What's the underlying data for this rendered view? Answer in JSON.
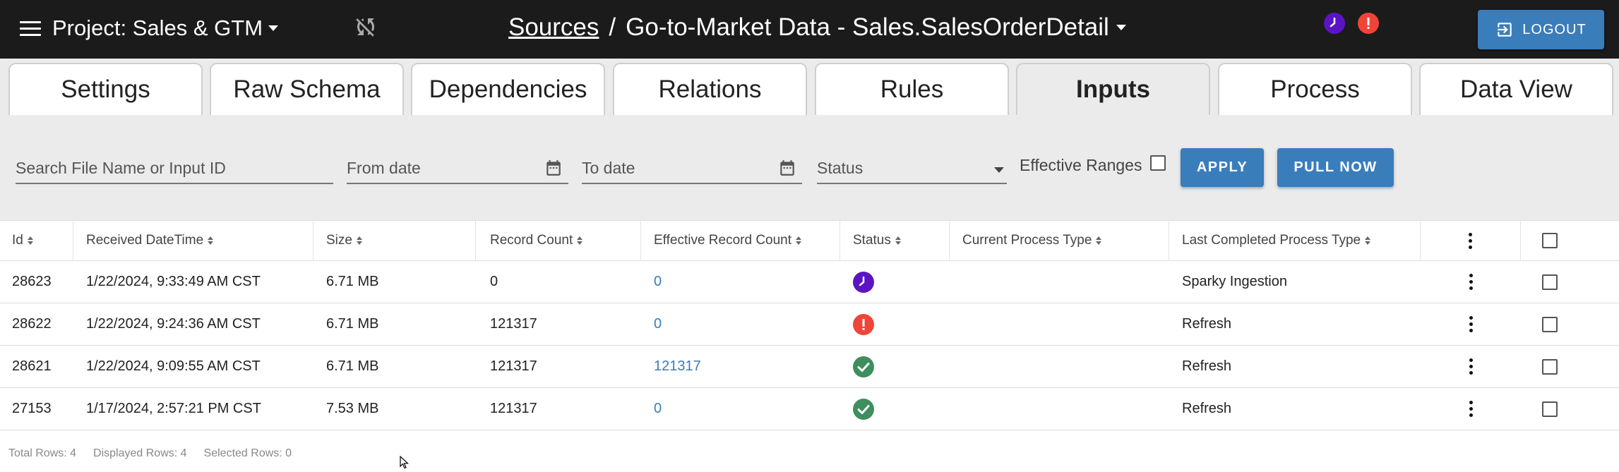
{
  "header": {
    "project_label": "Project:",
    "project_name": "Sales & GTM",
    "breadcrumb_link": "Sources",
    "breadcrumb_sep": "/",
    "page_title": "Go-to-Market Data - Sales.SalesOrderDetail",
    "logout_label": "LOGOUT",
    "status_colors": {
      "clock": "#5b14c4",
      "error": "#f04438"
    }
  },
  "tabs": [
    {
      "label": "Settings",
      "active": false
    },
    {
      "label": "Raw Schema",
      "active": false
    },
    {
      "label": "Dependencies",
      "active": false
    },
    {
      "label": "Relations",
      "active": false
    },
    {
      "label": "Rules",
      "active": false
    },
    {
      "label": "Inputs",
      "active": true
    },
    {
      "label": "Process",
      "active": false
    },
    {
      "label": "Data View",
      "active": false
    }
  ],
  "filters": {
    "search_placeholder": "Search File Name or Input ID",
    "from_placeholder": "From date",
    "to_placeholder": "To date",
    "status_placeholder": "Status",
    "effective_ranges_label": "Effective Ranges",
    "apply_label": "APPLY",
    "pull_now_label": "PULL NOW"
  },
  "table": {
    "columns": [
      "Id",
      "Received DateTime",
      "Size",
      "Record Count",
      "Effective Record Count",
      "Status",
      "Current Process Type",
      "Last Completed Process Type"
    ],
    "rows": [
      {
        "id": "28623",
        "received": "1/22/2024, 9:33:49 AM CST",
        "size": "6.71 MB",
        "records": "0",
        "effective": "0",
        "status": "clock",
        "current": "",
        "last": "Sparky Ingestion"
      },
      {
        "id": "28622",
        "received": "1/22/2024, 9:24:36 AM CST",
        "size": "6.71 MB",
        "records": "121317",
        "effective": "0",
        "status": "error",
        "current": "",
        "last": "Refresh"
      },
      {
        "id": "28621",
        "received": "1/22/2024, 9:09:55 AM CST",
        "size": "6.71 MB",
        "records": "121317",
        "effective": "121317",
        "status": "success",
        "current": "",
        "last": "Refresh"
      },
      {
        "id": "27153",
        "received": "1/17/2024, 2:57:21 PM CST",
        "size": "7.53 MB",
        "records": "121317",
        "effective": "0",
        "status": "success",
        "current": "",
        "last": "Refresh"
      }
    ]
  },
  "footer": {
    "total": "Total Rows: 4",
    "displayed": "Displayed Rows: 4",
    "selected": "Selected Rows: 0"
  }
}
